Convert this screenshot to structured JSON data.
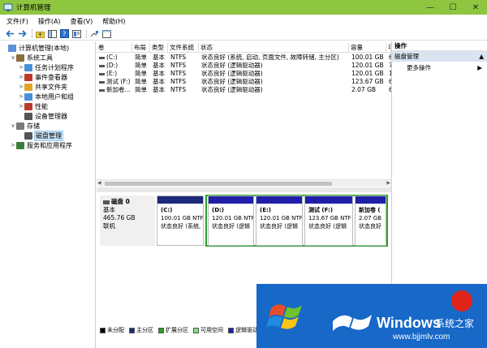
{
  "window": {
    "title": "计算机管理",
    "controls": [
      "—",
      "☐",
      "✕"
    ]
  },
  "menu": [
    "文件(F)",
    "操作(A)",
    "查看(V)",
    "帮助(H)"
  ],
  "tree": [
    {
      "label": "计算机管理(本地)",
      "level": 0,
      "exp": "",
      "icon": "computer-management-icon"
    },
    {
      "label": "系统工具",
      "level": 1,
      "exp": "∨",
      "icon": "tools-icon"
    },
    {
      "label": "任务计划程序",
      "level": 2,
      "exp": ">",
      "icon": "task-scheduler-icon"
    },
    {
      "label": "事件查看器",
      "level": 2,
      "exp": ">",
      "icon": "event-viewer-icon"
    },
    {
      "label": "共享文件夹",
      "level": 2,
      "exp": ">",
      "icon": "shared-folder-icon"
    },
    {
      "label": "本地用户和组",
      "level": 2,
      "exp": ">",
      "icon": "users-icon"
    },
    {
      "label": "性能",
      "level": 2,
      "exp": ">",
      "icon": "performance-icon"
    },
    {
      "label": "设备管理器",
      "level": 2,
      "exp": "",
      "icon": "device-manager-icon"
    },
    {
      "label": "存储",
      "level": 1,
      "exp": "∨",
      "icon": "storage-icon"
    },
    {
      "label": "磁盘管理",
      "level": 2,
      "exp": "",
      "icon": "disk-icon",
      "selected": true
    },
    {
      "label": "服务和应用程序",
      "level": 1,
      "exp": ">",
      "icon": "services-icon"
    }
  ],
  "list": {
    "headers": [
      "卷",
      "布局",
      "类型",
      "文件系统",
      "状态",
      "容量",
      "可"
    ],
    "rows": [
      [
        "(C:)",
        "简单",
        "基本",
        "NTFS",
        "状态良好 (系统, 启动, 页面文件, 故障转储, 主分区)",
        "100.01 GB",
        "6"
      ],
      [
        "(D:)",
        "简单",
        "基本",
        "NTFS",
        "状态良好 (逻辑驱动器)",
        "120.01 GB",
        "7"
      ],
      [
        "(E:)",
        "简单",
        "基本",
        "NTFS",
        "状态良好 (逻辑驱动器)",
        "120.01 GB",
        "1"
      ],
      [
        "测试 (F:)",
        "简单",
        "基本",
        "NTFS",
        "状态良好 (逻辑驱动器)",
        "123.67 GB",
        "6"
      ],
      [
        "新加卷...",
        "简单",
        "基本",
        "NTFS",
        "状态良好 (逻辑驱动器)",
        "2.07 GB",
        "6"
      ]
    ]
  },
  "disk": {
    "name": "磁盘 0",
    "type": "基本",
    "size": "465.76 GB",
    "status": "联机",
    "partitions": [
      {
        "name": "(C:)",
        "size": "100.01 GB NTF",
        "status": "状态良好 (系统,",
        "kind": "primary"
      },
      {
        "name": "(D:)",
        "size": "120.01 GB NTF",
        "status": "状态良好 (逻辑",
        "kind": "logical"
      },
      {
        "name": "(E:)",
        "size": "120.01 GB NTF",
        "status": "状态良好 (逻辑",
        "kind": "logical"
      },
      {
        "name": "测试 (F:)",
        "size": "123.67 GB NTF",
        "status": "状态良好 (逻辑",
        "kind": "logical"
      },
      {
        "name": "新加卷 (",
        "size": "2.07 GB",
        "status": "状态良好",
        "kind": "logical"
      }
    ]
  },
  "legend": [
    {
      "label": "未分配",
      "color": "#000000"
    },
    {
      "label": "主分区",
      "color": "#1a2a78"
    },
    {
      "label": "扩展分区",
      "color": "#2aa02a"
    },
    {
      "label": "可用空间",
      "color": "#7fe07f"
    },
    {
      "label": "逻辑驱动器",
      "color": "#1f1fa8"
    }
  ],
  "actions": {
    "header": "操作",
    "section": "磁盘管理",
    "more": "更多操作"
  },
  "watermark": {
    "brand": "Windows",
    "sys": "系统之家",
    "url": "www.bjjmlv.com"
  }
}
